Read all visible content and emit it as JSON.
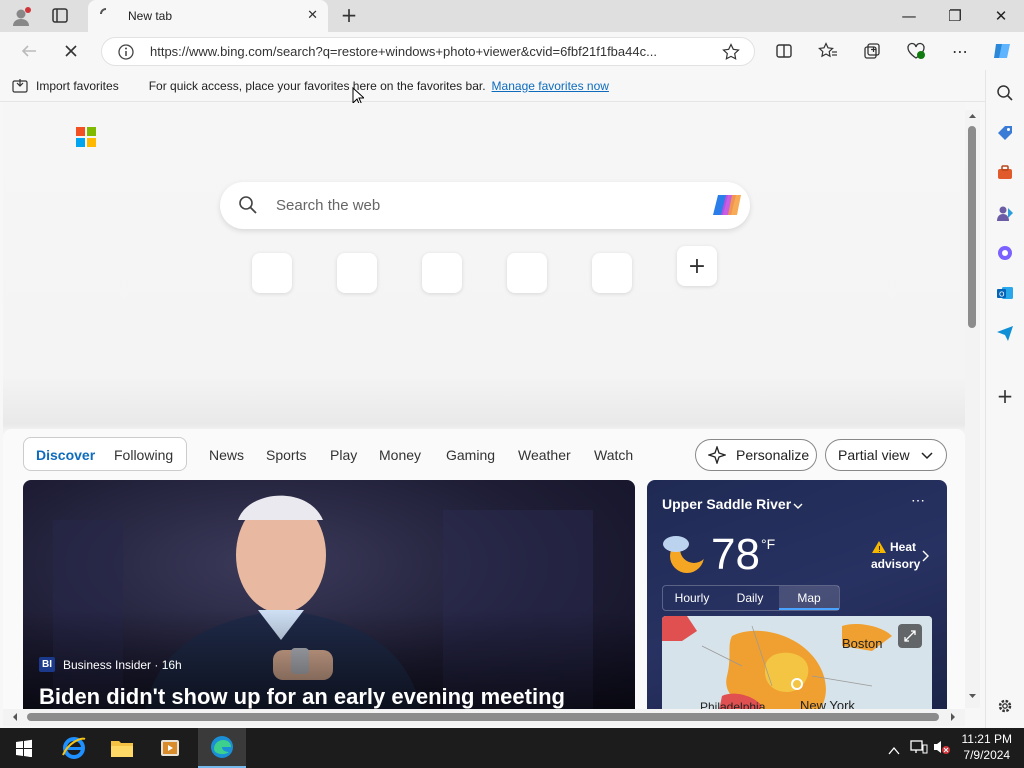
{
  "browser": {
    "tab": {
      "title": "New tab"
    },
    "url": "https://www.bing.com/search?q=restore+windows+photo+viewer&cvid=6fbf21f1fba44c...",
    "window_controls": {
      "minimize": "—",
      "maximize": "❐",
      "close": "✕"
    }
  },
  "favorites_bar": {
    "import_label": "Import favorites",
    "message": "For quick access, place your favorites here on the favorites bar.",
    "manage_link": "Manage favorites now"
  },
  "newtab": {
    "search_placeholder": "Search the web",
    "quick_links_count": 5
  },
  "feed": {
    "tabs": [
      "Discover",
      "Following",
      "News",
      "Sports",
      "Play",
      "Money",
      "Gaming",
      "Weather",
      "Watch"
    ],
    "active_tab": "Discover",
    "personalize_label": "Personalize",
    "view_label": "Partial view"
  },
  "news_card": {
    "source_logo": "BI",
    "source": "Business Insider · 16h",
    "headline": "Biden didn't show up for an early evening meeting"
  },
  "weather": {
    "location": "Upper Saddle River",
    "temperature": "78",
    "unit": "°F",
    "alert_line1": "Heat",
    "alert_line2": "advisory",
    "tabs": [
      "Hourly",
      "Daily",
      "Map"
    ],
    "active_tab": "Map",
    "map_labels": {
      "city1": "Boston",
      "city2": "Philadelphia",
      "city3": "New York"
    }
  },
  "taskbar": {
    "time": "11:21 PM",
    "date": "7/9/2024"
  },
  "colors": {
    "accent": "#0f6cbd",
    "taskbar": "#1c1c1c",
    "heat_orange": "#f0a030",
    "heat_red": "#e05050"
  }
}
